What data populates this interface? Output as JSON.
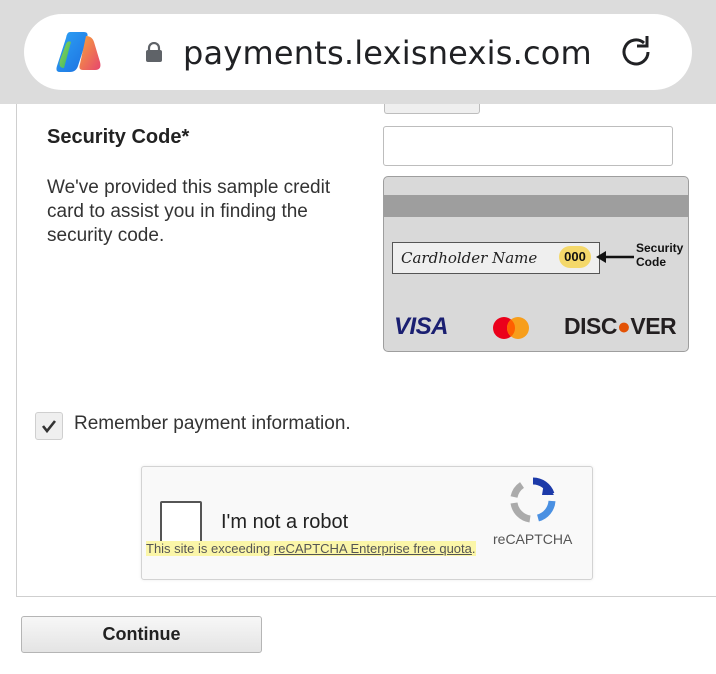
{
  "browser": {
    "url": "payments.lexisnexis.com",
    "app_icon": "copilot-icon",
    "lock_icon": "lock-icon",
    "reload_icon": "reload-icon"
  },
  "form": {
    "security_code_label": "Security Code*",
    "security_code_value": "",
    "help_text": "We've provided this sample credit card to assist you in finding the security code.",
    "sample_card": {
      "cardholder_name": "Cardholder Name",
      "cvv": "000",
      "security_code_note_line1": "Security",
      "security_code_note_line2": "Code",
      "brands": [
        "VISA",
        "DISCOVER"
      ],
      "discover_prefix": "DISC",
      "discover_suffix": "VER"
    },
    "remember_label": "Remember payment information.",
    "remember_checked": true
  },
  "captcha": {
    "label": "I'm not a robot",
    "brand": "reCAPTCHA",
    "quota_prefix": "This site is exceeding ",
    "quota_link": "reCAPTCHA Enterprise free quota",
    "quota_suffix": "."
  },
  "actions": {
    "continue_label": "Continue"
  },
  "colors": {
    "chrome_bg": "#dcdcdc",
    "visa_blue": "#1a1f71",
    "discover_orange": "#e35205",
    "highlight": "#fbf6a8"
  }
}
